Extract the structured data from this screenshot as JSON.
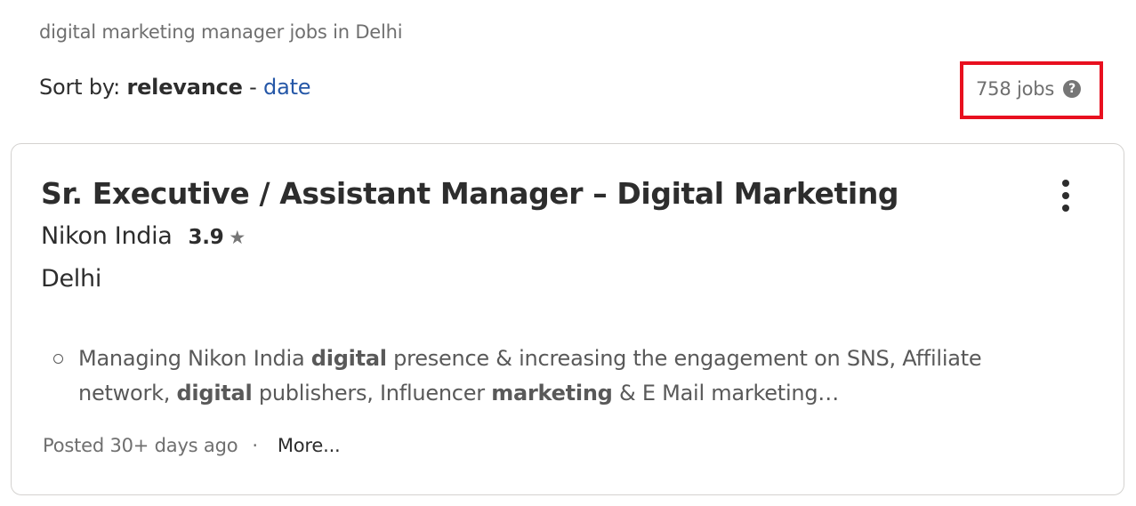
{
  "search": {
    "query_summary": "digital marketing manager jobs in Delhi"
  },
  "sort": {
    "label": "Sort by:",
    "active": "relevance",
    "separator": "-",
    "alternative": "date"
  },
  "results": {
    "count": "758 jobs",
    "help_icon": "question-mark-icon",
    "highlight_color": "#e8101f"
  },
  "job": {
    "title": "Sr. Executive / Assistant Manager – Digital Marketing",
    "company": "Nikon India",
    "rating": "3.9",
    "rating_icon": "star-icon",
    "location": "Delhi",
    "snippet": {
      "t1": "Managing Nikon India ",
      "b1": "digital",
      "t2": " presence & increasing the engagement on SNS, Affiliate network, ",
      "b2": "digital",
      "t3": " publishers, Influencer ",
      "b3": "marketing",
      "t4": " & E Mail marketing…"
    },
    "posted": "Posted 30+ days ago",
    "separator": "·",
    "more_label": "More..."
  },
  "colors": {
    "link": "#2557a7",
    "text": "#2d2d2d",
    "muted": "#6f6f6f"
  }
}
